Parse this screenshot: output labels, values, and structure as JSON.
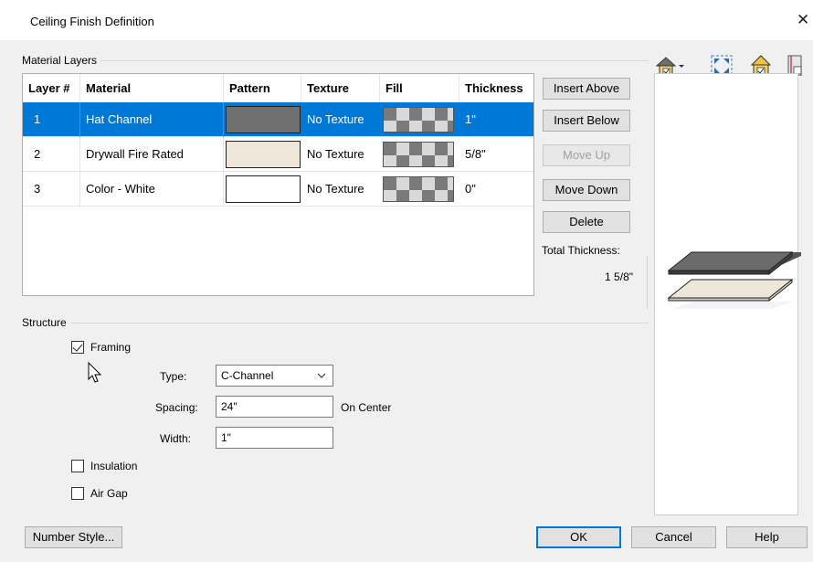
{
  "dialog": {
    "title": "Ceiling Finish Definition",
    "close_glyph": "✕"
  },
  "material_layers": {
    "group_label": "Material Layers",
    "columns": [
      "Layer #",
      "Material",
      "Pattern",
      "Texture",
      "Fill",
      "Thickness"
    ],
    "rows": [
      {
        "layer": "1",
        "material": "Hat Channel",
        "pattern_color": "#707070",
        "texture": "No Texture",
        "thickness": "1\"",
        "selected": true
      },
      {
        "layer": "2",
        "material": "Drywall Fire Rated",
        "pattern_color": "#ede6d9",
        "texture": "No Texture",
        "thickness": "5/8\"",
        "selected": false
      },
      {
        "layer": "3",
        "material": "Color - White",
        "pattern_color": "#ffffff",
        "texture": "No Texture",
        "thickness": "0\"",
        "selected": false
      }
    ]
  },
  "side_buttons": {
    "insert_above": "Insert Above",
    "insert_below": "Insert Below",
    "move_up": "Move Up",
    "move_down": "Move Down",
    "delete": "Delete"
  },
  "total_thickness": {
    "label": "Total Thickness:",
    "value": "1 5/8\""
  },
  "structure": {
    "group_label": "Structure",
    "framing_label": "Framing",
    "framing_checked": true,
    "type_label": "Type:",
    "type_value": "C-Channel",
    "spacing_label": "Spacing:",
    "spacing_value": "24\"",
    "on_center_label": "On Center",
    "width_label": "Width:",
    "width_value": "1\"",
    "insulation_label": "Insulation",
    "insulation_checked": false,
    "air_gap_label": "Air Gap",
    "air_gap_checked": false
  },
  "footer": {
    "number_style": "Number Style...",
    "ok": "OK",
    "cancel": "Cancel",
    "help": "Help"
  },
  "colors": {
    "accent": "#0078d7",
    "panel": "#f0f0f0"
  },
  "preview_toolbar_icons": [
    "house-view-icon",
    "fit-view-icon",
    "color-toggle-icon",
    "pattern-toggle-icon"
  ]
}
